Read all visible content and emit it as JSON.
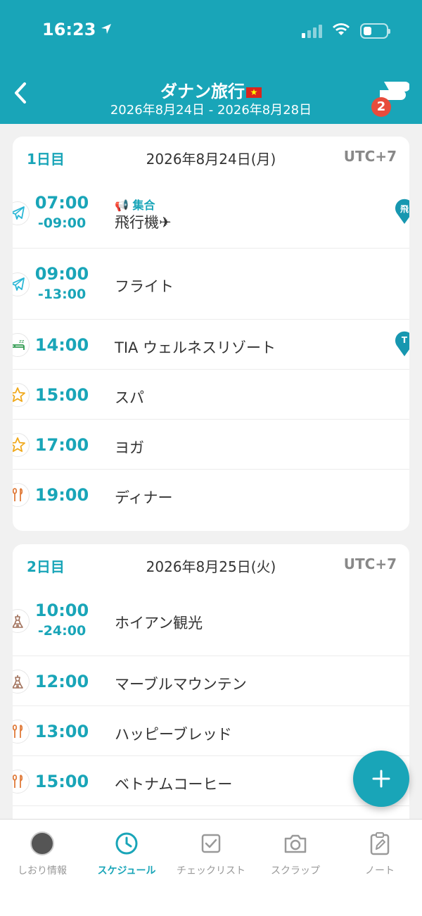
{
  "status_bar": {
    "time": "16:23"
  },
  "header": {
    "title": "ダナン旅行",
    "flag": "★",
    "date_range": "2026年8月24日 - 2026年8月28日",
    "chat_badge": "2",
    "accent_color": "#19a5b8"
  },
  "days": [
    {
      "label": "1日目",
      "date": "2026年8月24日(月)",
      "tz": "UTC+7",
      "items": [
        {
          "icon": "airplane-icon",
          "time": "07:00",
          "end": "-09:00",
          "tag": "集合",
          "title": "飛行機✈",
          "pin": "飛"
        },
        {
          "icon": "airplane-icon",
          "time": "09:00",
          "end": "-13:00",
          "title": "フライト"
        },
        {
          "icon": "bed-icon",
          "time": "14:00",
          "title": "TIA ウェルネスリゾート",
          "pin": "T"
        },
        {
          "icon": "star-icon",
          "time": "15:00",
          "title": "スパ"
        },
        {
          "icon": "star-icon",
          "time": "17:00",
          "title": "ヨガ"
        },
        {
          "icon": "food-icon",
          "time": "19:00",
          "title": "ディナー"
        }
      ]
    },
    {
      "label": "2日目",
      "date": "2026年8月25日(火)",
      "tz": "UTC+7",
      "items": [
        {
          "icon": "landmark-icon",
          "time": "10:00",
          "end": "-24:00",
          "title": "ホイアン観光"
        },
        {
          "icon": "landmark-icon",
          "time": "12:00",
          "title": "マーブルマウンテン"
        },
        {
          "icon": "food-icon",
          "time": "13:00",
          "title": "ハッピーブレッド"
        },
        {
          "icon": "food-icon",
          "time": "15:00",
          "title": "ベトナムコーヒー"
        }
      ]
    }
  ],
  "tabs": [
    {
      "label": "しおり情報",
      "icon": "avatar"
    },
    {
      "label": "スケジュール",
      "icon": "clock-icon",
      "active": true
    },
    {
      "label": "チェックリスト",
      "icon": "checkbox-icon"
    },
    {
      "label": "スクラップ",
      "icon": "camera-icon"
    },
    {
      "label": "ノート",
      "icon": "note-edit-icon"
    }
  ]
}
